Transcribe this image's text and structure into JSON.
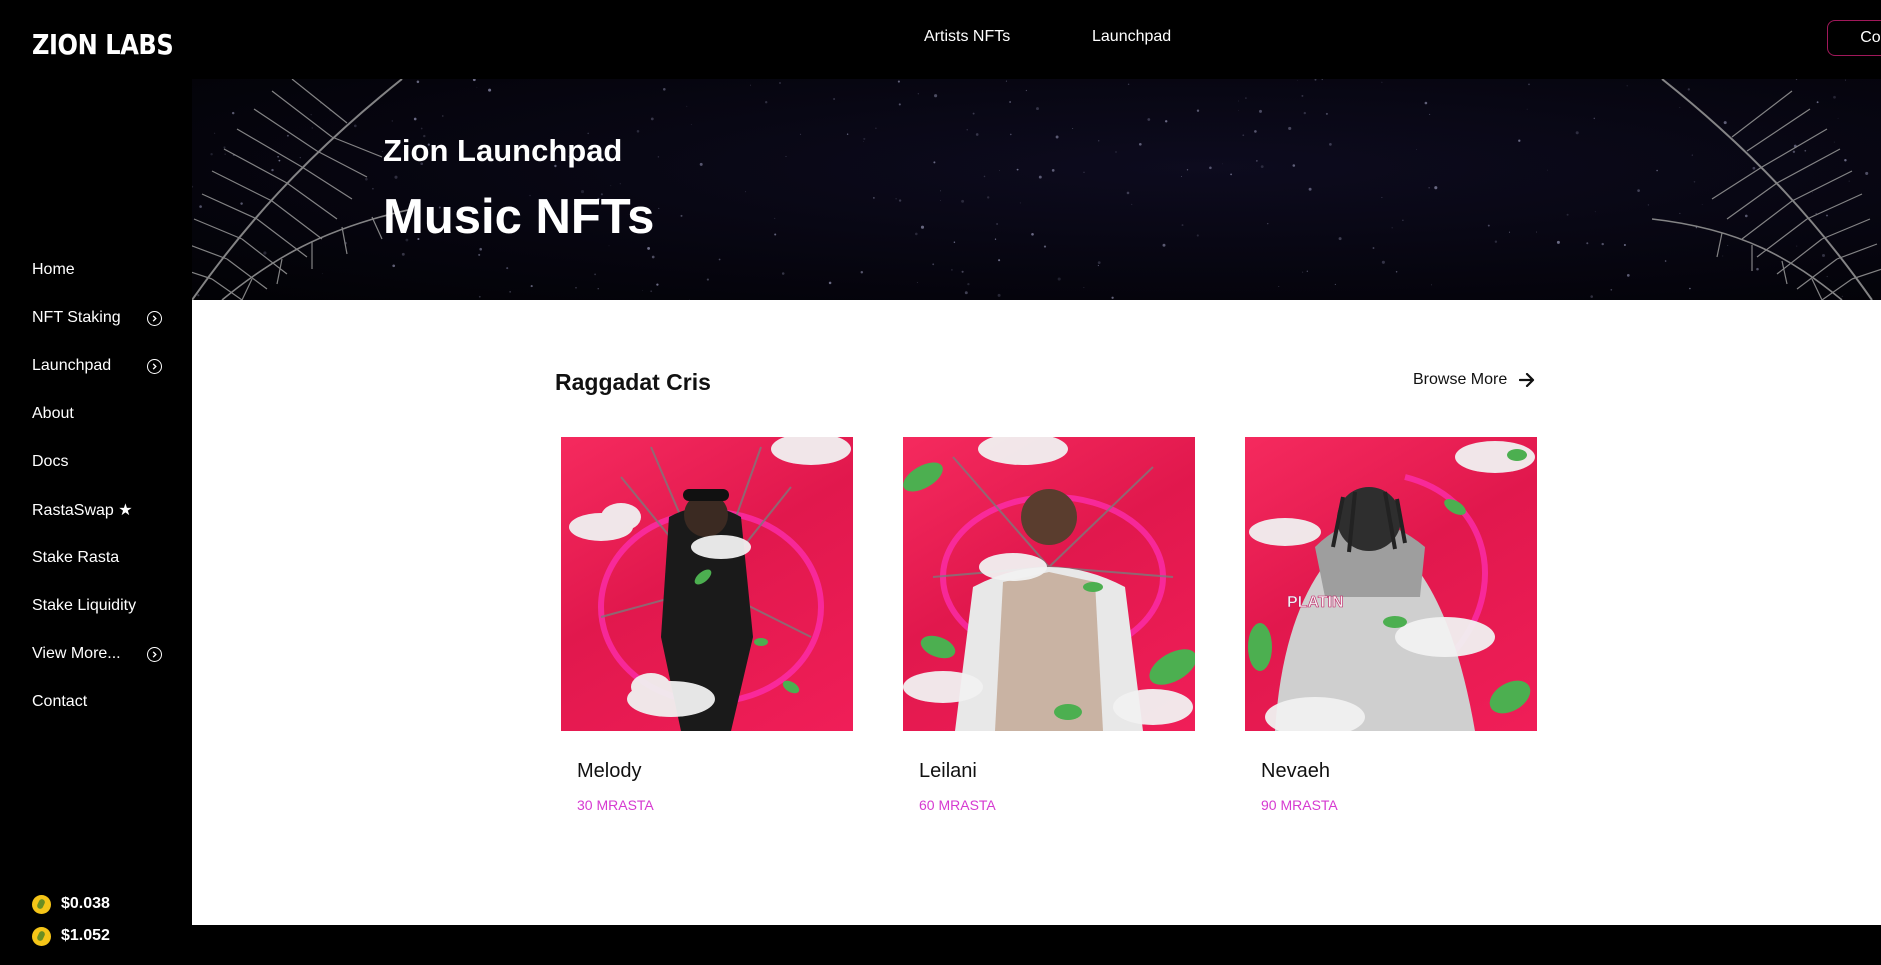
{
  "app": {
    "logo": "ZION LABS"
  },
  "sidebar": {
    "items": [
      {
        "label": "Home",
        "has_chevron": false
      },
      {
        "label": "NFT Staking",
        "has_chevron": true
      },
      {
        "label": "Launchpad",
        "has_chevron": true
      },
      {
        "label": "About",
        "has_chevron": false
      },
      {
        "label": "Docs",
        "has_chevron": false
      },
      {
        "label": "RastaSwap ★",
        "has_chevron": false
      },
      {
        "label": "Stake Rasta",
        "has_chevron": false
      },
      {
        "label": "Stake Liquidity",
        "has_chevron": false
      },
      {
        "label": "View More...",
        "has_chevron": true
      },
      {
        "label": "Contact",
        "has_chevron": false
      }
    ],
    "prices": [
      {
        "value": "$0.038",
        "icon": "coin-icon"
      },
      {
        "value": "$1.052",
        "icon": "coin-icon"
      }
    ]
  },
  "topbar": {
    "links": [
      "Artists NFTs",
      "Launchpad"
    ],
    "connect_label": "Connect"
  },
  "hero": {
    "subtitle": "Zion Launchpad",
    "title": "Music NFTs"
  },
  "collection": {
    "title": "Raggadat Cris",
    "browse_label": "Browse More",
    "cards": [
      {
        "name": "Melody",
        "price": "30 MRASTA"
      },
      {
        "name": "Leilani",
        "price": "60 MRASTA"
      },
      {
        "name": "Nevaeh",
        "price": "90 MRASTA"
      }
    ]
  },
  "colors": {
    "accent": "#d63ad1",
    "connect_border": "#a0185a",
    "card_background": "#e91e56"
  }
}
